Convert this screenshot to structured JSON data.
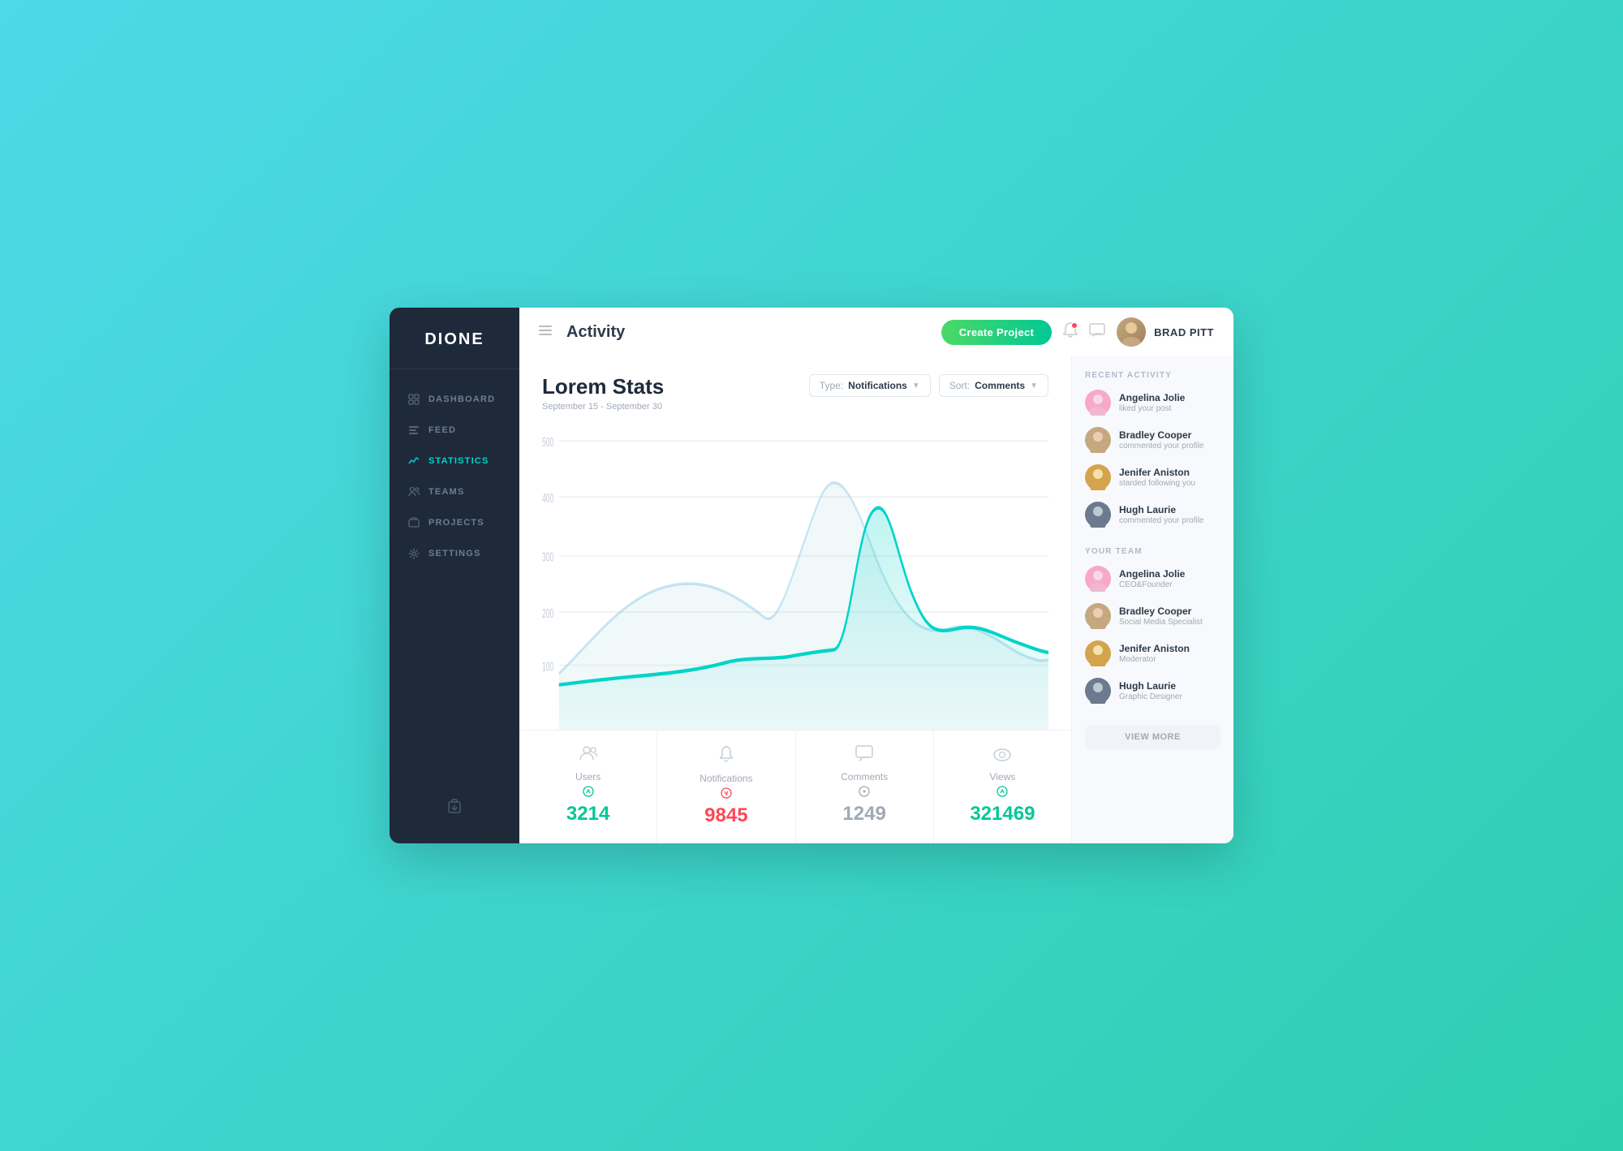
{
  "app": {
    "logo": "DIONE",
    "background_color": "#1e2a3a"
  },
  "sidebar": {
    "items": [
      {
        "id": "dashboard",
        "label": "Dashboard",
        "active": false
      },
      {
        "id": "feed",
        "label": "Feed",
        "active": false
      },
      {
        "id": "statistics",
        "label": "Statistics",
        "active": true
      },
      {
        "id": "teams",
        "label": "Teams",
        "active": false
      },
      {
        "id": "projects",
        "label": "Projects",
        "active": false
      },
      {
        "id": "settings",
        "label": "Settings",
        "active": false
      }
    ],
    "footer_icon": "share"
  },
  "topbar": {
    "title": "Activity",
    "create_button": "Create Project",
    "user": {
      "name": "BRAD PITT"
    }
  },
  "chart": {
    "title": "Lorem Stats",
    "subtitle": "September 15 - September 30",
    "type_label": "Type:",
    "type_value": "Notifications",
    "sort_label": "Sort:",
    "sort_value": "Comments"
  },
  "stats": [
    {
      "id": "users",
      "label": "Users",
      "value": "3214",
      "trend": "up",
      "color": "green"
    },
    {
      "id": "notifications",
      "label": "Notifications",
      "value": "9845",
      "trend": "down",
      "color": "red"
    },
    {
      "id": "comments",
      "label": "Comments",
      "value": "1249",
      "trend": "neutral",
      "color": "gray"
    },
    {
      "id": "views",
      "label": "Views",
      "value": "321469",
      "trend": "up",
      "color": "green"
    }
  ],
  "recent_activity": {
    "title": "RECENT ACTIVITY",
    "items": [
      {
        "name": "Angelina Jolie",
        "desc": "liked your post",
        "avatar_color": "#f9a8c9"
      },
      {
        "name": "Bradley Cooper",
        "desc": "commented your profile",
        "avatar_color": "#c5a880"
      },
      {
        "name": "Jenifer Aniston",
        "desc": "starded following you",
        "avatar_color": "#d4a44c"
      },
      {
        "name": "Hugh Laurie",
        "desc": "commented your profile",
        "avatar_color": "#6b7a8e"
      }
    ]
  },
  "your_team": {
    "title": "YOUR TEAM",
    "items": [
      {
        "name": "Angelina Jolie",
        "role": "CEO&Founder",
        "avatar_color": "#f9a8c9"
      },
      {
        "name": "Bradley Cooper",
        "role": "Social Media Specialist",
        "avatar_color": "#c5a880"
      },
      {
        "name": "Jenifer Aniston",
        "role": "Moderator",
        "avatar_color": "#d4a44c"
      },
      {
        "name": "Hugh Laurie",
        "role": "Graphic Designer",
        "avatar_color": "#6b7a8e"
      }
    ],
    "view_more": "VIEW MORE"
  }
}
